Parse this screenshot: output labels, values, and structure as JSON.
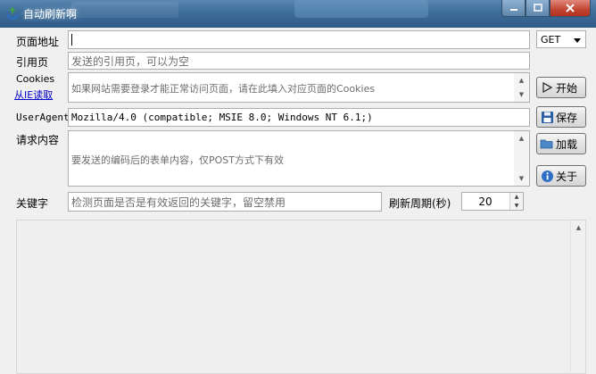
{
  "window": {
    "title": "自动刷新啊"
  },
  "form": {
    "url_label": "页面地址",
    "url_value": "",
    "method": "GET",
    "referer_label": "引用页",
    "referer_placeholder": "发送的引用页，可以为空",
    "cookies_label": "Cookies",
    "cookies_link": "从IE读取",
    "cookies_placeholder": "如果网站需要登录才能正常访问页面，请在此填入对应页面的Cookies",
    "useragent_label": "UserAgent",
    "useragent_value": "Mozilla/4.0 (compatible; MSIE 8.0; Windows NT 6.1;)",
    "body_label": "请求内容",
    "body_placeholder": "要发送的编码后的表单内容，仅POST方式下有效",
    "keyword_label": "关键字",
    "keyword_placeholder": "检测页面是否是有效返回的关键字，留空禁用",
    "period_label": "刷新周期(秒)",
    "period_value": "20"
  },
  "buttons": {
    "start": "开始",
    "save": "保存",
    "load": "加载",
    "about": "关于"
  },
  "icons": {
    "app": "recycle-icon",
    "start": "play-icon",
    "save": "floppy-icon",
    "load": "folder-icon",
    "about": "info-icon"
  }
}
